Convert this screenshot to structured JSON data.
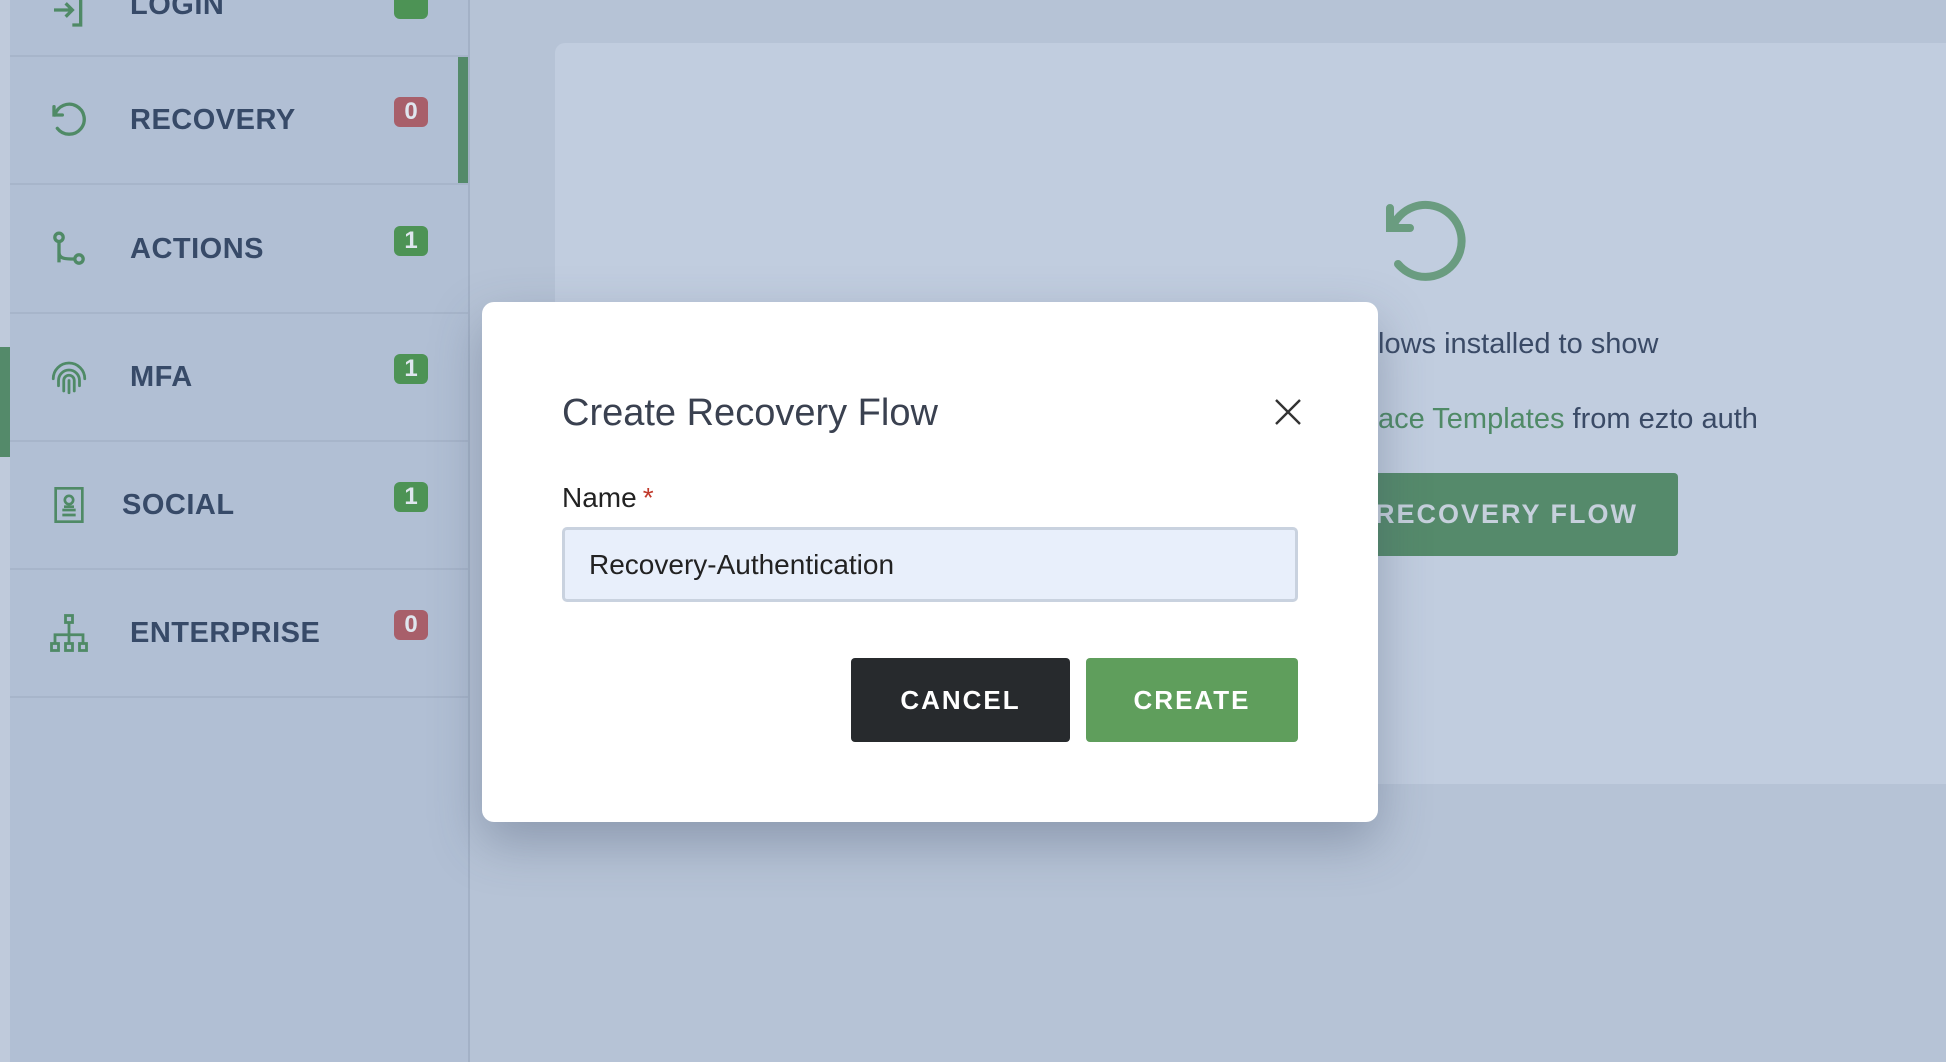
{
  "sidebar": {
    "items": [
      {
        "label": "LOGIN",
        "badge": "",
        "badge_color": "green",
        "icon": "login-icon"
      },
      {
        "label": "RECOVERY",
        "badge": "0",
        "badge_color": "red",
        "icon": "history-icon",
        "active": true
      },
      {
        "label": "ACTIONS",
        "badge": "1",
        "badge_color": "green",
        "icon": "route-icon"
      },
      {
        "label": "MFA",
        "badge": "1",
        "badge_color": "green",
        "icon": "fingerprint-icon"
      },
      {
        "label": "SOCIAL",
        "badge": "1",
        "badge_color": "green",
        "icon": "contact-card-icon"
      },
      {
        "label": "ENTERPRISE",
        "badge": "0",
        "badge_color": "red",
        "icon": "org-chart-icon"
      }
    ]
  },
  "empty_state": {
    "line1": "lows installed to show",
    "line2_link": "ace Templates",
    "line2_rest": " from ezto auth",
    "button": "E RECOVERY FLOW"
  },
  "modal": {
    "title": "Create Recovery Flow",
    "name_label": "Name",
    "required_mark": "*",
    "name_value": "Recovery-Authentication",
    "cancel": "CANCEL",
    "create": "CREATE"
  },
  "colors": {
    "accent": "#5f9e5c",
    "badge_red": "#a85f6a",
    "badge_green": "#4d9355"
  }
}
